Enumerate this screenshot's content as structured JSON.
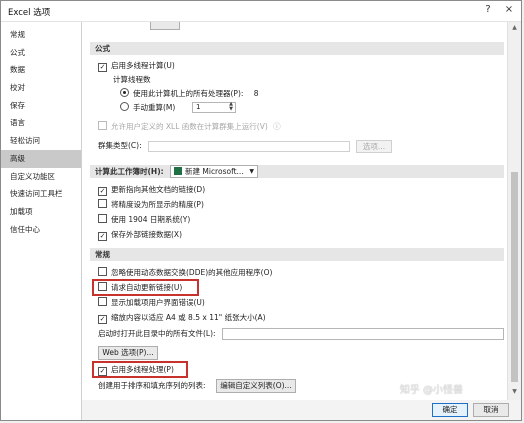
{
  "window": {
    "title": "Excel 选项",
    "help_glyph": "?",
    "close_glyph": "×"
  },
  "sidebar": {
    "items": [
      {
        "label": "常规"
      },
      {
        "label": "公式"
      },
      {
        "label": "数据"
      },
      {
        "label": "校对"
      },
      {
        "label": "保存"
      },
      {
        "label": "语言"
      },
      {
        "label": "轻松访问"
      },
      {
        "label": "高级"
      },
      {
        "label": "自定义功能区"
      },
      {
        "label": "快速访问工具栏"
      },
      {
        "label": "加载项"
      },
      {
        "label": "信任中心"
      }
    ],
    "active_index": 7
  },
  "formulas": {
    "header": "公式",
    "multithread_label": "启用多线程计算(U)",
    "threads_label": "计算线程数",
    "use_all_label": "使用此计算机上的所有处理器(P):",
    "processor_count": "8",
    "manual_label": "手动重算(M)",
    "manual_value": "1",
    "xll_label": "允许用户定义的 XLL 函数在计算群集上运行(V)",
    "cluster_type_label": "群集类型(C):",
    "options_button": "选项..."
  },
  "workbook_calc": {
    "header": "计算此工作簿时(H):",
    "workbook_name": "新建 Microsoft...",
    "items": [
      {
        "label": "更新指向其他文档的链接(D)",
        "checked": true
      },
      {
        "label": "将精度设为所显示的精度(P)",
        "checked": false
      },
      {
        "label": "使用 1904 日期系统(Y)",
        "checked": false
      },
      {
        "label": "保存外部链接数据(X)",
        "checked": true
      }
    ]
  },
  "general": {
    "header": "常规",
    "items": [
      {
        "label": "忽略使用动态数据交换(DDE)的其他应用程序(O)",
        "checked": false
      },
      {
        "label": "请求自动更新链接(U)",
        "checked": false
      },
      {
        "label": "显示加载项用户界面错误(U)",
        "checked": false
      },
      {
        "label": "缩放内容以适应 A4 或 8.5 x 11\" 纸张大小(A)",
        "checked": true
      }
    ],
    "startup_label": "启动时打开此目录中的所有文件(L):",
    "web_options_button": "Web 选项(P)...",
    "multithread_processing_label": "启用多线程处理(P)",
    "multithread_processing_checked": true,
    "custom_list_label": "创建用于排序和填充序列的列表:",
    "custom_list_button": "编辑自定义列表(O)..."
  },
  "footer": {
    "ok_label": "确定",
    "cancel_label": "取消"
  },
  "watermark": "知乎 @小怪兽"
}
